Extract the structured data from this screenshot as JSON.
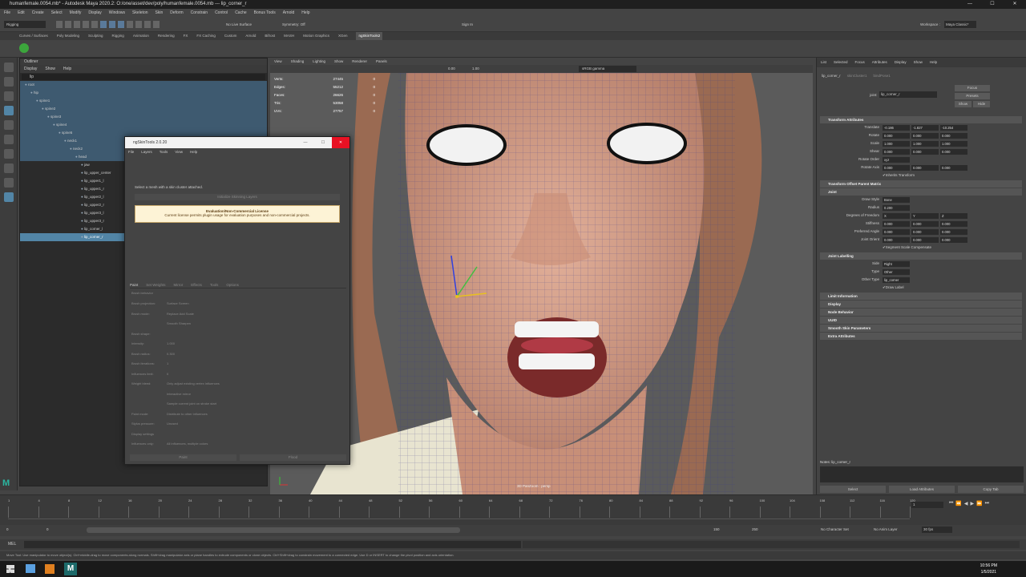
{
  "window": {
    "title": "humanfemale.0054.mb* - Autodesk Maya 2020.2: O:/one/asset/dev/poly/humanfemale.0054.mb --- lip_corner_r"
  },
  "menubar": [
    "File",
    "Edit",
    "Create",
    "Select",
    "Modify",
    "Display",
    "Windows",
    "Skeleton",
    "Skin",
    "Deform",
    "Constrain",
    "Control",
    "Cache",
    "Bonus Tools",
    "Arnold",
    "Help"
  ],
  "statusline": {
    "mode": "Rigging",
    "symmetry": "Symmetry: Off",
    "surface": "No Live Surface",
    "signin": "Sign In",
    "workspace_label": "Workspace :",
    "workspace": "Maya Classic*"
  },
  "shelf_tabs": [
    "Curves / Surfaces",
    "Poly Modeling",
    "Sculpting",
    "Rigging",
    "Animation",
    "Rendering",
    "FX",
    "FX Caching",
    "Custom",
    "Arnold",
    "Bifrost",
    "MASH",
    "Motion Graphics",
    "XGen",
    "ngSkinTools2"
  ],
  "shelf_active": "ngSkinTools2",
  "outliner": {
    "title": "Outliner",
    "menu": [
      "Display",
      "Show",
      "Help"
    ],
    "search": "lip",
    "items": [
      {
        "label": "root",
        "indent": 0,
        "state": "hl"
      },
      {
        "label": "hip",
        "indent": 1,
        "state": "hl"
      },
      {
        "label": "spine1",
        "indent": 2,
        "state": "hl"
      },
      {
        "label": "spine2",
        "indent": 3,
        "state": "hl"
      },
      {
        "label": "spine3",
        "indent": 4,
        "state": "hl"
      },
      {
        "label": "spine4",
        "indent": 5,
        "state": "hl"
      },
      {
        "label": "spine5",
        "indent": 6,
        "state": "hl"
      },
      {
        "label": "neck1",
        "indent": 7,
        "state": "hl"
      },
      {
        "label": "neck2",
        "indent": 8,
        "state": "hl"
      },
      {
        "label": "head",
        "indent": 9,
        "state": "hl"
      },
      {
        "label": "jaw",
        "indent": 10,
        "state": ""
      },
      {
        "label": "lip_upper_center",
        "indent": 10,
        "state": ""
      },
      {
        "label": "lip_upper1_l",
        "indent": 10,
        "state": ""
      },
      {
        "label": "lip_upper1_r",
        "indent": 10,
        "state": ""
      },
      {
        "label": "lip_upper2_l",
        "indent": 10,
        "state": ""
      },
      {
        "label": "lip_upper2_r",
        "indent": 10,
        "state": ""
      },
      {
        "label": "lip_upper3_l",
        "indent": 10,
        "state": ""
      },
      {
        "label": "lip_upper3_r",
        "indent": 10,
        "state": ""
      },
      {
        "label": "lip_corner_l",
        "indent": 10,
        "state": ""
      },
      {
        "label": "lip_corner_r",
        "indent": 10,
        "state": "sel"
      }
    ]
  },
  "viewport": {
    "menu": [
      "View",
      "Shading",
      "Lighting",
      "Show",
      "Renderer",
      "Panels"
    ],
    "gamma": "sRGB gamma",
    "exposure": "0.00",
    "gamma_val": "1.00",
    "hud": [
      {
        "k": "Verts:",
        "v": "27445",
        "z": "0"
      },
      {
        "k": "Edges:",
        "v": "55212",
        "z": "0"
      },
      {
        "k": "Faces:",
        "v": "26626",
        "z": "0"
      },
      {
        "k": "Tris:",
        "v": "53058",
        "z": "0"
      },
      {
        "k": "UVs:",
        "v": "27757",
        "z": "0"
      }
    ],
    "camera_label": "3D PanZoom : persp"
  },
  "skin_window": {
    "title": "ngSkinTools 2.0.20",
    "menu": [
      "File",
      "Layers",
      "Tools",
      "View",
      "Help"
    ],
    "hint": "Select a mesh with a skin cluster attached.",
    "init_button": "Initialize Skinning Layers",
    "license_title": "Evaluation/Non-Commercial License",
    "license_text": "Current license permits plugin usage for evaluation purposes and non-commercial projects.",
    "tabs": [
      "Paint",
      "Set Weights",
      "Mirror",
      "Effects",
      "Tools",
      "Options"
    ],
    "section": "Brush behavior",
    "rows": [
      {
        "k": "Brush projection:",
        "v": "Surface    Screen"
      },
      {
        "k": "Brush mode:",
        "v": "Replace    Add    Scale"
      },
      {
        "k": "",
        "v": "Smooth    Sharpen"
      },
      {
        "k": "Brush shape:",
        "v": ""
      },
      {
        "k": "Intensity:",
        "v": "1.000"
      },
      {
        "k": "Brush radius:",
        "v": "0.300"
      },
      {
        "k": "Brush iterations:",
        "v": "1"
      },
      {
        "k": "Influences limit:",
        "v": "0"
      },
      {
        "k": "Weight bleed:",
        "v": "Only adjust existing vertex influences"
      },
      {
        "k": "",
        "v": "Interactive mirror"
      },
      {
        "k": "",
        "v": "Sample current joint on stroke start"
      },
      {
        "k": "Paint mode:",
        "v": "Distribute to other influences"
      },
      {
        "k": "Stylus pressure:",
        "v": "Unused"
      },
      {
        "k": "Display settings",
        "v": ""
      },
      {
        "k": "Influences only:",
        "v": "All influences, multiple colors"
      }
    ],
    "footer": [
      "Paint",
      "Flood"
    ]
  },
  "attribute_editor": {
    "menu": [
      "List",
      "Selected",
      "Focus",
      "Attributes",
      "Display",
      "Show",
      "Help"
    ],
    "tabs": [
      "lip_corner_r",
      "skinCluster1",
      "bindPose1"
    ],
    "joint_label": "joint:",
    "joint_name": "lip_corner_r",
    "buttons": [
      "Focus",
      "Presets",
      "Show",
      "Hide"
    ],
    "sections": [
      "Transform Attributes",
      "Transform Offset Parent Matrix",
      "Joint",
      "Joint Labelling",
      "Limit Information",
      "Display",
      "Node Behavior",
      "UUID",
      "Smooth Skin Parameters",
      "Extra Attributes"
    ],
    "transform": [
      {
        "k": "Translate",
        "v": [
          "-0.186",
          "-1.827",
          "-10.254"
        ]
      },
      {
        "k": "Rotate",
        "v": [
          "0.000",
          "0.000",
          "0.000"
        ]
      },
      {
        "k": "Scale",
        "v": [
          "1.000",
          "1.000",
          "1.000"
        ]
      },
      {
        "k": "Shear",
        "v": [
          "0.000",
          "0.000",
          "0.000"
        ]
      },
      {
        "k": "Rotate Order",
        "v": [
          "xyz"
        ]
      },
      {
        "k": "Rotate Axis",
        "v": [
          "0.000",
          "0.000",
          "0.000"
        ]
      }
    ],
    "inherits": "Inherits Transform",
    "joint": [
      {
        "k": "Draw Style",
        "v": [
          "Bone"
        ]
      },
      {
        "k": "Radius",
        "v": [
          "0.200"
        ]
      },
      {
        "k": "Degrees of Freedom",
        "v": [
          "X",
          "Y",
          "Z"
        ]
      },
      {
        "k": "Stiffness",
        "v": [
          "0.000",
          "0.000",
          "0.000"
        ]
      },
      {
        "k": "Preferred Angle",
        "v": [
          "0.000",
          "0.000",
          "0.000"
        ]
      },
      {
        "k": "Joint Orient",
        "v": [
          "0.000",
          "0.000",
          "0.000"
        ]
      }
    ],
    "segment": "Segment Scale Compensate",
    "labelling": [
      {
        "k": "Side",
        "v": [
          "Right"
        ]
      },
      {
        "k": "Type",
        "v": [
          "Other"
        ]
      },
      {
        "k": "Other Type",
        "v": [
          "lip_corner"
        ]
      }
    ],
    "draw_label": "Draw Label",
    "notes": "Notes: lip_corner_r",
    "footer": [
      "Select",
      "Load Attributes",
      "Copy Tab"
    ]
  },
  "timeline": {
    "ticks": [
      "1",
      "4",
      "8",
      "12",
      "16",
      "20",
      "24",
      "28",
      "32",
      "36",
      "40",
      "44",
      "48",
      "52",
      "56",
      "60",
      "64",
      "68",
      "72",
      "76",
      "80",
      "84",
      "88",
      "92",
      "96",
      "100",
      "104",
      "108",
      "112",
      "116",
      "120"
    ],
    "current": "1"
  },
  "range": {
    "start": "0",
    "inner_start": "0",
    "end_a": "150",
    "end_b": "250",
    "char_set": "No Character Set",
    "anim_layer": "No Anim Layer",
    "fps": "30 fps"
  },
  "cmdline": {
    "label": "MEL"
  },
  "helpline": "Move Tool: Use manipulator to move object(s). Ctrl+middle-drag to move components along normals. Shift+drag manipulator axis or plane handles to extrude components or clone objects. Ctrl+Shift+drag to constrain movement to a connected edge. Use D or INSERT to change the pivot position and axis orientation.",
  "taskbar": {
    "time": "10:56 PM",
    "date": "1/5/2021"
  },
  "colors": {
    "selection": "#5285a6",
    "license_bg": "#fdf3d6",
    "skin": "#d8a58c",
    "wire": "#3a3a8c"
  }
}
